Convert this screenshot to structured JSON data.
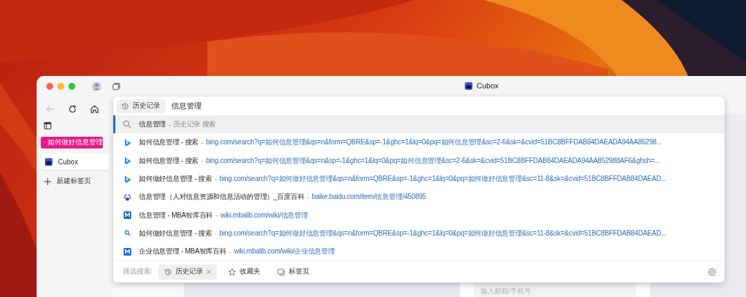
{
  "window": {
    "title": "Cubox"
  },
  "toolbar": {
    "back": {
      "disabled": true
    }
  },
  "address_bar": {
    "scope_chip": "历史记录",
    "value": "信息管理"
  },
  "sidebar": {
    "group_label": "如何做好信息管理",
    "tabs": [
      {
        "title": "Cubox",
        "selected": true
      }
    ],
    "new_tab": "新建标签页"
  },
  "suggestions": [
    {
      "kind": "search",
      "title": "信息管理",
      "separator": "-",
      "detail": "历史记录 搜索",
      "selected": true
    },
    {
      "kind": "bing",
      "title": "如何信息管理 - 搜索",
      "separator": "-",
      "url": "bing.com/search?q=如何信息管理&qs=n&form=QBRE&sp=-1&ghc=1&lq=0&pq=如何信息管理&sc=2-6&sk=&cvid=51BC8BFFDAB84DAEADA94AA85298...",
      "selected": false
    },
    {
      "kind": "bing",
      "title": "如何信息管理 - 搜索",
      "separator": "-",
      "url": "bing.com/search?q=如何信息管理&qs=n&sp=-1&ghc=1&lq=0&pq=如何信息管理&sc=2-6&sk=&cvid=51BC8BFFDAB84DAEADA94AA852988AF6&ghsh=...",
      "selected": false
    },
    {
      "kind": "bing",
      "title": "如何做好信息管理 - 搜索",
      "separator": "-",
      "url": "bing.com/search?q=如何做好信息管理&qs=n&form=QBRE&sp=-1&ghc=1&lq=0&pq=如何做好信息管理&sc=11-8&sk=&cvid=51BC8BFFDAB84DAEAD...",
      "selected": false
    },
    {
      "kind": "baidu",
      "title": "信息管理（人对信息资源和信息活动的管理）_百度百科",
      "separator": "-",
      "url": "baike.baidu.com/item/信息管理/450895",
      "selected": false
    },
    {
      "kind": "mbalib",
      "title": "信息管理 - MBA智库百科",
      "separator": "-",
      "url": "wiki.mbalib.com/wiki/信息管理",
      "selected": false
    },
    {
      "kind": "web-search",
      "title": "如何做好信息管理 - 搜索",
      "separator": "-",
      "url": "bing.com/search?q=如何做好信息管理&qs=n&form=QBRE&sp=-1&ghc=1&lq=0&pq=如何做好信息管理&sc=11-8&sk=&cvid=51BC8BFFDAB84DAEAD...",
      "selected": false
    },
    {
      "kind": "mbalib",
      "title": "企业信息管理 - MBA智库百科",
      "separator": "-",
      "url": "wiki.mbalib.com/wiki/企业信息管理",
      "selected": false
    }
  ],
  "filter": {
    "label": "筛选搜索:",
    "options": [
      {
        "kind": "history",
        "label": "历史记录",
        "selected": true
      },
      {
        "kind": "bookmarks",
        "label": "收藏夹",
        "selected": false
      },
      {
        "kind": "tabs",
        "label": "标签页",
        "selected": false
      }
    ]
  },
  "page_behind": {
    "login_field": {
      "placeholder": "输入邮箱/手机号"
    }
  }
}
